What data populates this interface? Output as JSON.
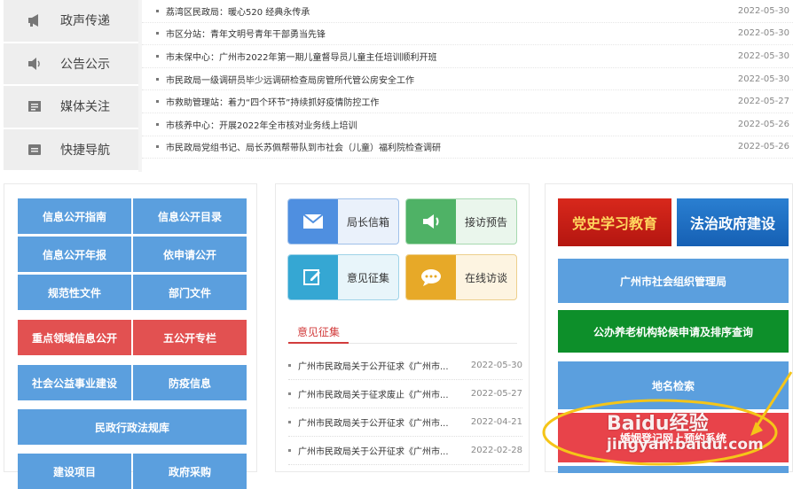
{
  "sidebar": {
    "items": [
      {
        "label": "政声传递",
        "icon": "megaphone-icon"
      },
      {
        "label": "公告公示",
        "icon": "speaker-icon"
      },
      {
        "label": "媒体关注",
        "icon": "newspaper-icon"
      },
      {
        "label": "快捷导航",
        "icon": "navigation-icon"
      }
    ]
  },
  "news": [
    {
      "title": "荔湾区民政局：暖心520 经典永传承",
      "date": "2022-05-30"
    },
    {
      "title": "市区分站：青年文明号青年干部勇当先锋",
      "date": "2022-05-30"
    },
    {
      "title": "市未保中心：广州市2022年第一期儿童督导员儿童主任培训顺利开班",
      "date": "2022-05-30"
    },
    {
      "title": "市民政局一级调研员毕少远调研检查局房管所代管公房安全工作",
      "date": "2022-05-30"
    },
    {
      "title": "市救助管理站：着力“四个环节”持续抓好疫情防控工作",
      "date": "2022-05-27"
    },
    {
      "title": "市核养中心：开展2022年全市核对业务线上培训",
      "date": "2022-05-26"
    },
    {
      "title": "市民政局党组书记、局长苏佩帮带队到市社会（儿童）福利院检查调研",
      "date": "2022-05-26"
    }
  ],
  "info_grid": {
    "items": [
      "信息公开指南",
      "信息公开目录",
      "信息公开年报",
      "依申请公开",
      "规范性文件",
      "部门文件",
      "重点领域信息公开",
      "五公开专栏",
      "社会公益事业建设",
      "防疫信息",
      "民政行政法规库",
      "建设项目",
      "政府采购"
    ]
  },
  "services": {
    "tiles": [
      {
        "label": "局长信箱",
        "icon": "mail-icon"
      },
      {
        "label": "接访预告",
        "icon": "speaker-icon"
      },
      {
        "label": "意见征集",
        "icon": "edit-icon"
      },
      {
        "label": "在线访谈",
        "icon": "chat-icon"
      }
    ],
    "section_title": "意见征集",
    "opinions": [
      {
        "title": "广州市民政局关于公开征求《广州市...",
        "date": "2022-05-30"
      },
      {
        "title": "广州市民政局关于征求废止《广州市...",
        "date": "2022-05-27"
      },
      {
        "title": "广州市民政局关于公开征求《广州市...",
        "date": "2022-04-21"
      },
      {
        "title": "广州市民政局关于公开征求《广州市...",
        "date": "2022-02-28"
      }
    ]
  },
  "links": {
    "banner_left": "党史学习教育",
    "banner_right": "法治政府建设",
    "buttons": [
      "广州市社会组织管理局",
      "公办养老机构轮候申请及排序查询",
      "地名检索",
      "婚姻登记网上预约系统"
    ]
  },
  "watermark": {
    "brand": "Baidu经验",
    "url": "jingyan.baidu.com"
  },
  "colors": {
    "blue_button": "#5b9fde",
    "red_button": "#e25151",
    "green_button": "#0d8f2a",
    "annotation": "#f5c518"
  }
}
